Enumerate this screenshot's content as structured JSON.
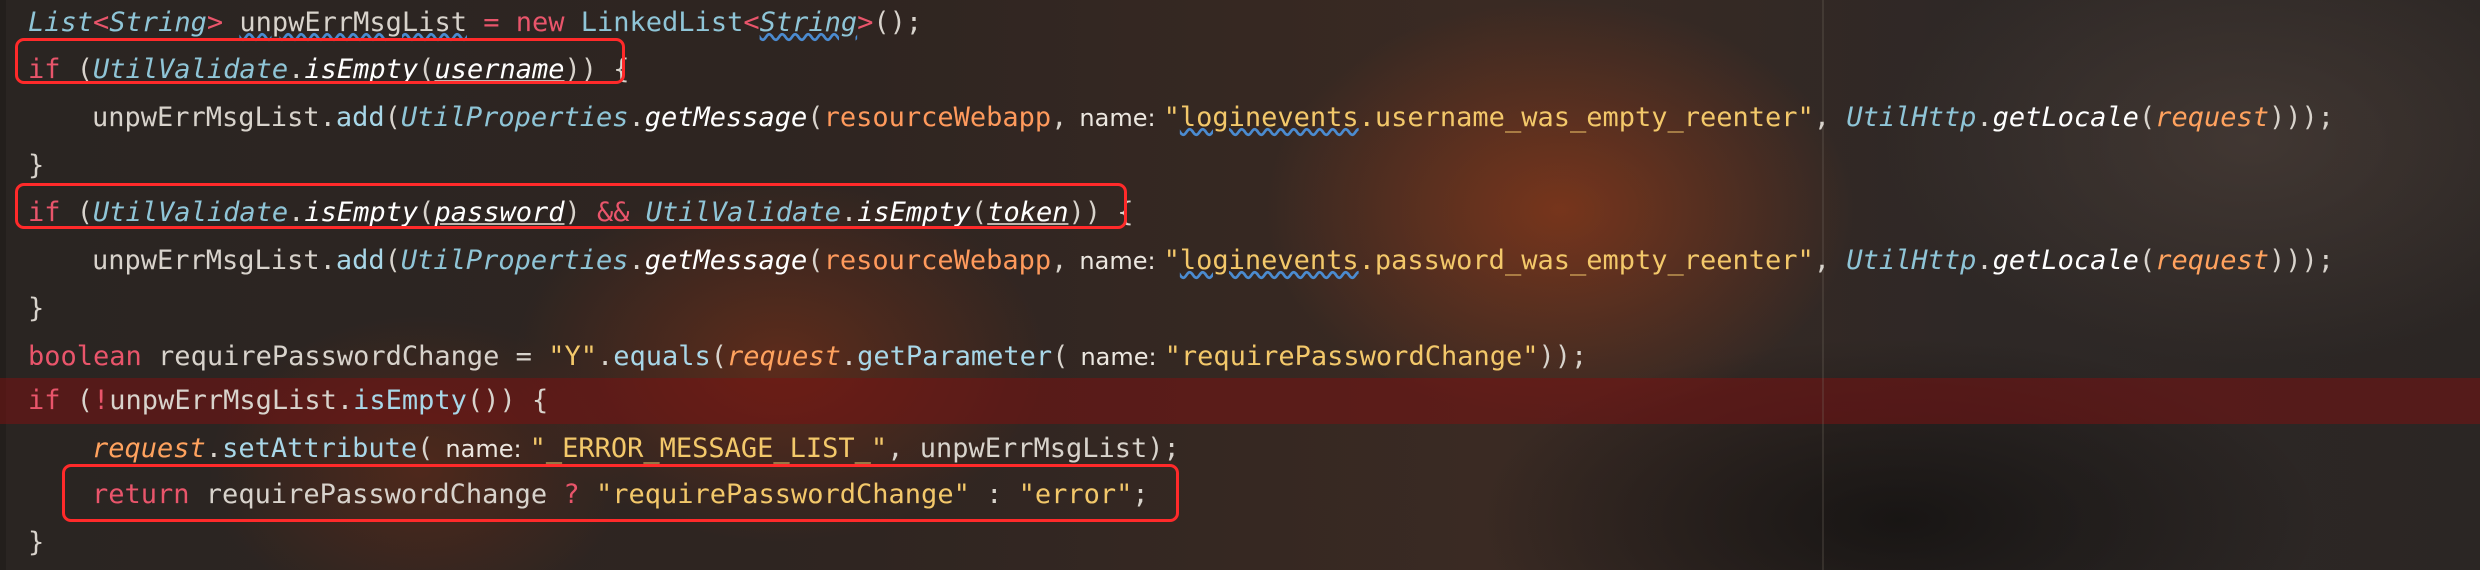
{
  "lines": [
    {
      "indent": 0,
      "tokens": [
        {
          "text": "List",
          "c": "t"
        },
        {
          "text": "<",
          "c": "k"
        },
        {
          "text": "String",
          "c": "t"
        },
        {
          "text": ">",
          "c": "k"
        },
        {
          "text": " ",
          "c": "p"
        },
        {
          "text": "unpwErrMsgList",
          "c": "p",
          "u": "sq"
        },
        {
          "text": " = ",
          "c": "k"
        },
        {
          "text": "new",
          "c": "k"
        },
        {
          "text": " LinkedList",
          "c": "cls"
        },
        {
          "text": "<",
          "c": "k"
        },
        {
          "text": "String",
          "c": "t",
          "u": "sq"
        },
        {
          "text": ">",
          "c": "k"
        },
        {
          "text": "();",
          "c": "p"
        }
      ]
    },
    {
      "indent": 0,
      "tokens": [
        {
          "text": "if",
          "c": "k"
        },
        {
          "text": " (",
          "c": "p"
        },
        {
          "text": "UtilValidate",
          "c": "t"
        },
        {
          "text": ".",
          "c": "p"
        },
        {
          "text": "isEmpty",
          "c": "sm"
        },
        {
          "text": "(",
          "c": "p"
        },
        {
          "text": "username",
          "c": "sm",
          "u": "u"
        },
        {
          "text": ")) {",
          "c": "p"
        }
      ]
    },
    {
      "indent": 1,
      "tokens": [
        {
          "text": "unpwErrMsgList",
          "c": "p"
        },
        {
          "text": ".",
          "c": "p"
        },
        {
          "text": "add",
          "c": "m"
        },
        {
          "text": "(",
          "c": "p"
        },
        {
          "text": "UtilProperties",
          "c": "t"
        },
        {
          "text": ".",
          "c": "p"
        },
        {
          "text": "getMessage",
          "c": "sm"
        },
        {
          "text": "(",
          "c": "p"
        },
        {
          "text": "resourceWebapp",
          "c": "v"
        },
        {
          "text": ",",
          "c": "p"
        },
        {
          "text": "name:",
          "c": "hint"
        },
        {
          "text": "\"",
          "c": "s"
        },
        {
          "text": "loginevents",
          "c": "s",
          "u": "sq"
        },
        {
          "text": ".username_was_empty_reenter\"",
          "c": "s"
        },
        {
          "text": ", ",
          "c": "p"
        },
        {
          "text": "UtilHttp",
          "c": "t"
        },
        {
          "text": ".",
          "c": "p"
        },
        {
          "text": "getLocale",
          "c": "sm"
        },
        {
          "text": "(",
          "c": "p"
        },
        {
          "text": "request",
          "c": "vi"
        },
        {
          "text": ")));",
          "c": "p"
        }
      ]
    },
    {
      "indent": 0,
      "tokens": [
        {
          "text": "}",
          "c": "p"
        }
      ]
    },
    {
      "indent": 0,
      "tokens": [
        {
          "text": "if",
          "c": "k"
        },
        {
          "text": " (",
          "c": "p"
        },
        {
          "text": "UtilValidate",
          "c": "t"
        },
        {
          "text": ".",
          "c": "p"
        },
        {
          "text": "isEmpty",
          "c": "sm"
        },
        {
          "text": "(",
          "c": "p"
        },
        {
          "text": "password",
          "c": "sm",
          "u": "u"
        },
        {
          "text": ") ",
          "c": "p"
        },
        {
          "text": "&&",
          "c": "k"
        },
        {
          "text": " ",
          "c": "p"
        },
        {
          "text": "UtilValidate",
          "c": "t"
        },
        {
          "text": ".",
          "c": "p"
        },
        {
          "text": "isEmpty",
          "c": "sm"
        },
        {
          "text": "(",
          "c": "p"
        },
        {
          "text": "token",
          "c": "sm",
          "u": "u"
        },
        {
          "text": ")) {",
          "c": "p"
        }
      ]
    },
    {
      "indent": 1,
      "tokens": [
        {
          "text": "unpwErrMsgList",
          "c": "p"
        },
        {
          "text": ".",
          "c": "p"
        },
        {
          "text": "add",
          "c": "m"
        },
        {
          "text": "(",
          "c": "p"
        },
        {
          "text": "UtilProperties",
          "c": "t"
        },
        {
          "text": ".",
          "c": "p"
        },
        {
          "text": "getMessage",
          "c": "sm"
        },
        {
          "text": "(",
          "c": "p"
        },
        {
          "text": "resourceWebapp",
          "c": "v"
        },
        {
          "text": ",",
          "c": "p"
        },
        {
          "text": "name:",
          "c": "hint"
        },
        {
          "text": "\"",
          "c": "s"
        },
        {
          "text": "loginevents",
          "c": "s",
          "u": "sq"
        },
        {
          "text": ".password_was_empty_reenter\"",
          "c": "s"
        },
        {
          "text": ", ",
          "c": "p"
        },
        {
          "text": "UtilHttp",
          "c": "t"
        },
        {
          "text": ".",
          "c": "p"
        },
        {
          "text": "getLocale",
          "c": "sm"
        },
        {
          "text": "(",
          "c": "p"
        },
        {
          "text": "request",
          "c": "vi"
        },
        {
          "text": ")));",
          "c": "p"
        }
      ]
    },
    {
      "indent": 0,
      "tokens": [
        {
          "text": "}",
          "c": "p"
        }
      ]
    },
    {
      "indent": 0,
      "tokens": [
        {
          "text": "boolean",
          "c": "k"
        },
        {
          "text": " requirePasswordChange = ",
          "c": "p"
        },
        {
          "text": "\"Y\"",
          "c": "s"
        },
        {
          "text": ".",
          "c": "p"
        },
        {
          "text": "equals",
          "c": "m"
        },
        {
          "text": "(",
          "c": "p"
        },
        {
          "text": "request",
          "c": "vi"
        },
        {
          "text": ".",
          "c": "p"
        },
        {
          "text": "getParameter",
          "c": "m"
        },
        {
          "text": "(",
          "c": "p"
        },
        {
          "text": "name:",
          "c": "hint"
        },
        {
          "text": "\"requirePasswordChange\"",
          "c": "s"
        },
        {
          "text": "));",
          "c": "p"
        }
      ]
    },
    {
      "indent": 0,
      "tokens": [
        {
          "text": "if",
          "c": "k"
        },
        {
          "text": " (",
          "c": "p"
        },
        {
          "text": "!",
          "c": "k"
        },
        {
          "text": "unpwErrMsgList",
          "c": "p"
        },
        {
          "text": ".",
          "c": "p"
        },
        {
          "text": "isEmpty",
          "c": "m"
        },
        {
          "text": "()) {",
          "c": "p"
        }
      ]
    },
    {
      "indent": 1,
      "tokens": [
        {
          "text": "request",
          "c": "vi"
        },
        {
          "text": ".",
          "c": "p"
        },
        {
          "text": "setAttribute",
          "c": "m"
        },
        {
          "text": "(",
          "c": "p"
        },
        {
          "text": "name:",
          "c": "hint"
        },
        {
          "text": "\"_ERROR_MESSAGE_LIST_\"",
          "c": "s"
        },
        {
          "text": ", unpwErrMsgList);",
          "c": "p"
        }
      ]
    },
    {
      "indent": 1,
      "tokens": [
        {
          "text": "return",
          "c": "k"
        },
        {
          "text": " requirePasswordChange ",
          "c": "p"
        },
        {
          "text": "?",
          "c": "k"
        },
        {
          "text": " ",
          "c": "p"
        },
        {
          "text": "\"requirePasswordChange\"",
          "c": "s"
        },
        {
          "text": " : ",
          "c": "p"
        },
        {
          "text": "\"error\"",
          "c": "s"
        },
        {
          "text": ";",
          "c": "p"
        }
      ]
    },
    {
      "indent": 0,
      "tokens": [
        {
          "text": "}",
          "c": "p"
        }
      ]
    }
  ],
  "highlighted_line": 8,
  "colors": {
    "keyword": "#e9556b",
    "type": "#8fc5d7",
    "string": "#f3c86a",
    "field": "#ff9a5c",
    "annotation_box": "#ff2a2a",
    "error_line": "#781212"
  }
}
